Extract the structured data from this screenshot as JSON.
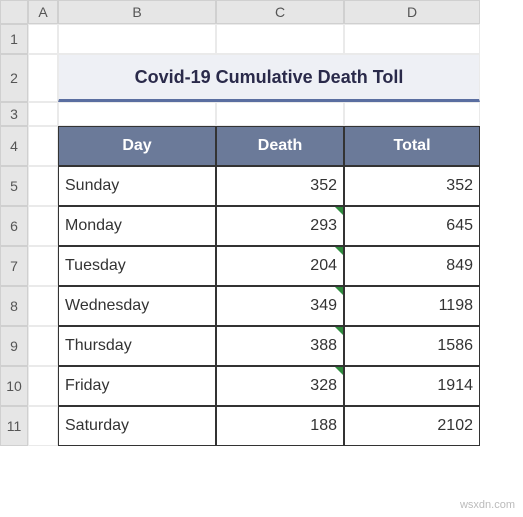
{
  "columns": [
    "A",
    "B",
    "C",
    "D"
  ],
  "rows": [
    "1",
    "2",
    "3",
    "4",
    "5",
    "6",
    "7",
    "8",
    "9",
    "10",
    "11"
  ],
  "title": "Covid-19 Cumulative Death Toll",
  "headers": {
    "day": "Day",
    "death": "Death",
    "total": "Total"
  },
  "table": [
    {
      "day": "Sunday",
      "death": 352,
      "total": 352
    },
    {
      "day": "Monday",
      "death": 293,
      "total": 645
    },
    {
      "day": "Tuesday",
      "death": 204,
      "total": 849
    },
    {
      "day": "Wednesday",
      "death": 349,
      "total": 1198
    },
    {
      "day": "Thursday",
      "death": 388,
      "total": 1586
    },
    {
      "day": "Friday",
      "death": 328,
      "total": 1914
    },
    {
      "day": "Saturday",
      "death": 188,
      "total": 2102
    }
  ],
  "watermark": "wsxdn.com",
  "chart_data": {
    "type": "table",
    "title": "Covid-19 Cumulative Death Toll",
    "categories": [
      "Sunday",
      "Monday",
      "Tuesday",
      "Wednesday",
      "Thursday",
      "Friday",
      "Saturday"
    ],
    "series": [
      {
        "name": "Death",
        "values": [
          352,
          293,
          204,
          349,
          388,
          328,
          188
        ]
      },
      {
        "name": "Total",
        "values": [
          352,
          645,
          849,
          1198,
          1586,
          1914,
          2102
        ]
      }
    ]
  }
}
